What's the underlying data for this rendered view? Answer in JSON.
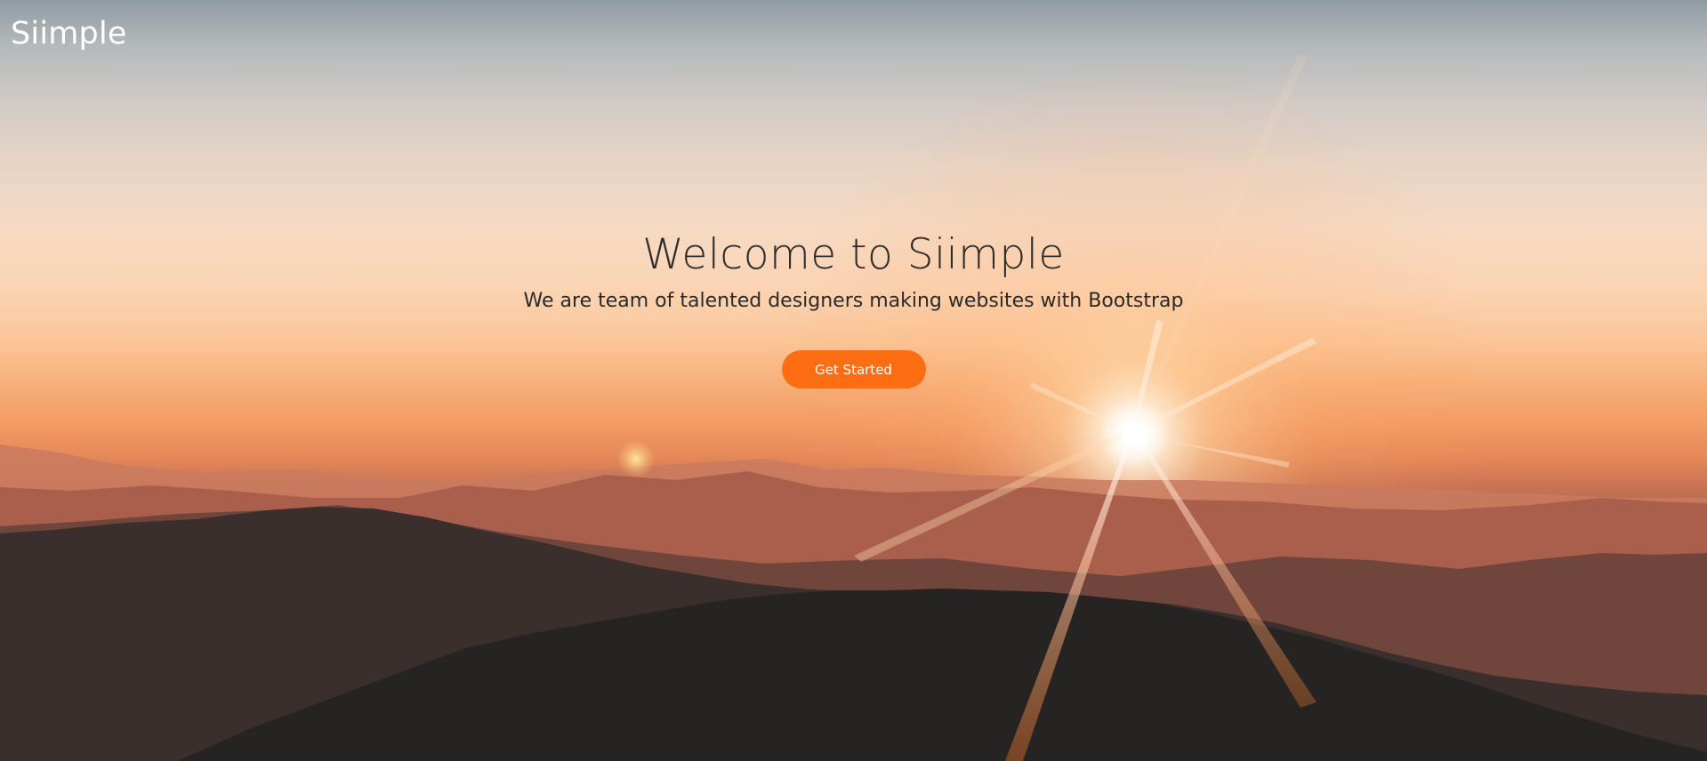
{
  "header": {
    "brand": "Siimple"
  },
  "hero": {
    "title": "Welcome to Siimple",
    "subtitle": "We are team of talented designers making websites with Bootstrap",
    "cta_label": "Get Started"
  },
  "colors": {
    "accent": "#fd6e13",
    "text_dark": "#2f2d2c",
    "brand_text": "#ffffff"
  }
}
